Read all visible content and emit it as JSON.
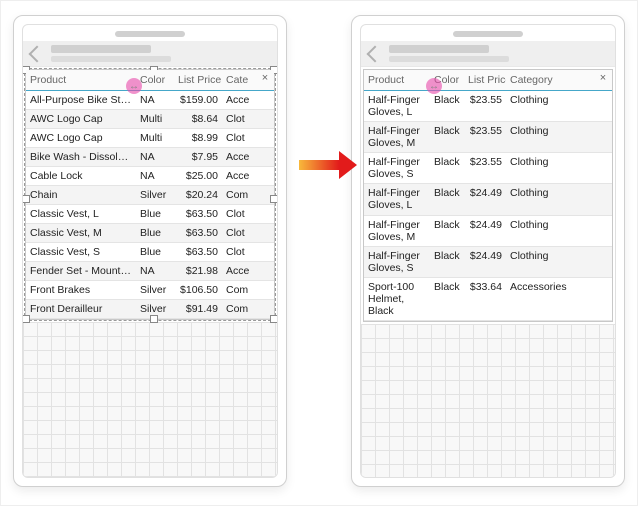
{
  "columns": {
    "product": "Product",
    "color": "Color",
    "price": "List Price",
    "category": "Category",
    "category_clipped": "Cate"
  },
  "close_label": "×",
  "left_rows": [
    {
      "product": "All-Purpose Bike Stand",
      "color": "NA",
      "price": "$159.00",
      "cat": "Acce"
    },
    {
      "product": "AWC Logo Cap",
      "color": "Multi",
      "price": "$8.64",
      "cat": "Clot"
    },
    {
      "product": "AWC Logo Cap",
      "color": "Multi",
      "price": "$8.99",
      "cat": "Clot"
    },
    {
      "product": "Bike Wash - Dissolver",
      "color": "NA",
      "price": "$7.95",
      "cat": "Acce"
    },
    {
      "product": "Cable Lock",
      "color": "NA",
      "price": "$25.00",
      "cat": "Acce"
    },
    {
      "product": "Chain",
      "color": "Silver",
      "price": "$20.24",
      "cat": "Com"
    },
    {
      "product": "Classic Vest, L",
      "color": "Blue",
      "price": "$63.50",
      "cat": "Clot"
    },
    {
      "product": "Classic Vest, M",
      "color": "Blue",
      "price": "$63.50",
      "cat": "Clot"
    },
    {
      "product": "Classic Vest, S",
      "color": "Blue",
      "price": "$63.50",
      "cat": "Clot"
    },
    {
      "product": "Fender Set - Mountain",
      "color": "NA",
      "price": "$21.98",
      "cat": "Acce"
    },
    {
      "product": "Front Brakes",
      "color": "Silver",
      "price": "$106.50",
      "cat": "Com"
    },
    {
      "product": "Front Derailleur",
      "color": "Silver",
      "price": "$91.49",
      "cat": "Com"
    }
  ],
  "right_rows": [
    {
      "product": "Half-Finger Gloves, L",
      "color": "Black",
      "price": "$23.55",
      "cat": "Clothing"
    },
    {
      "product": "Half-Finger Gloves, M",
      "color": "Black",
      "price": "$23.55",
      "cat": "Clothing"
    },
    {
      "product": "Half-Finger Gloves, S",
      "color": "Black",
      "price": "$23.55",
      "cat": "Clothing"
    },
    {
      "product": "Half-Finger Gloves, L",
      "color": "Black",
      "price": "$24.49",
      "cat": "Clothing"
    },
    {
      "product": "Half-Finger Gloves, M",
      "color": "Black",
      "price": "$24.49",
      "cat": "Clothing"
    },
    {
      "product": "Half-Finger Gloves, S",
      "color": "Black",
      "price": "$24.49",
      "cat": "Clothing"
    },
    {
      "product": "Sport-100 Helmet, Black",
      "color": "Black",
      "price": "$33.64",
      "cat": "Accessories"
    }
  ]
}
